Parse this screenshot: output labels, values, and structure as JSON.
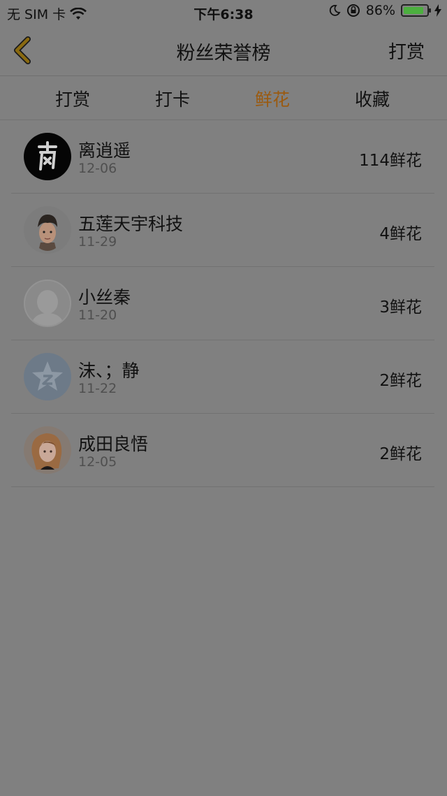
{
  "status_bar": {
    "carrier": "无 SIM 卡",
    "time": "下午6:38",
    "battery_percent": "86%",
    "battery_level": 0.86,
    "icons": [
      "wifi-icon",
      "moon-icon",
      "rotation-lock-icon",
      "battery-icon",
      "charging-bolt-icon"
    ]
  },
  "nav": {
    "title": "粉丝荣誉榜",
    "right_action": "打赏",
    "back_icon": "chevron-left-icon",
    "accent_color": "#9a5a10"
  },
  "tabs": [
    {
      "label": "打赏",
      "active": false
    },
    {
      "label": "打卡",
      "active": false
    },
    {
      "label": "鲜花",
      "active": true
    },
    {
      "label": "收藏",
      "active": false
    }
  ],
  "list": [
    {
      "name": "离逍遥",
      "date": "12-06",
      "count": "114鲜花",
      "avatar": "calligraphy-avatar"
    },
    {
      "name": "五莲天宇科技",
      "date": "11-29",
      "count": "4鲜花",
      "avatar": "cartoon-boy-avatar"
    },
    {
      "name": "小丝秦",
      "date": "11-20",
      "count": "3鲜花",
      "avatar": "default-silhouette-avatar"
    },
    {
      "name": "沫、；静",
      "date": "11-22",
      "count": "2鲜花",
      "avatar": "qzone-star-avatar"
    },
    {
      "name": "成田良悟",
      "date": "12-05",
      "count": "2鲜花",
      "avatar": "anime-girl-avatar"
    }
  ]
}
